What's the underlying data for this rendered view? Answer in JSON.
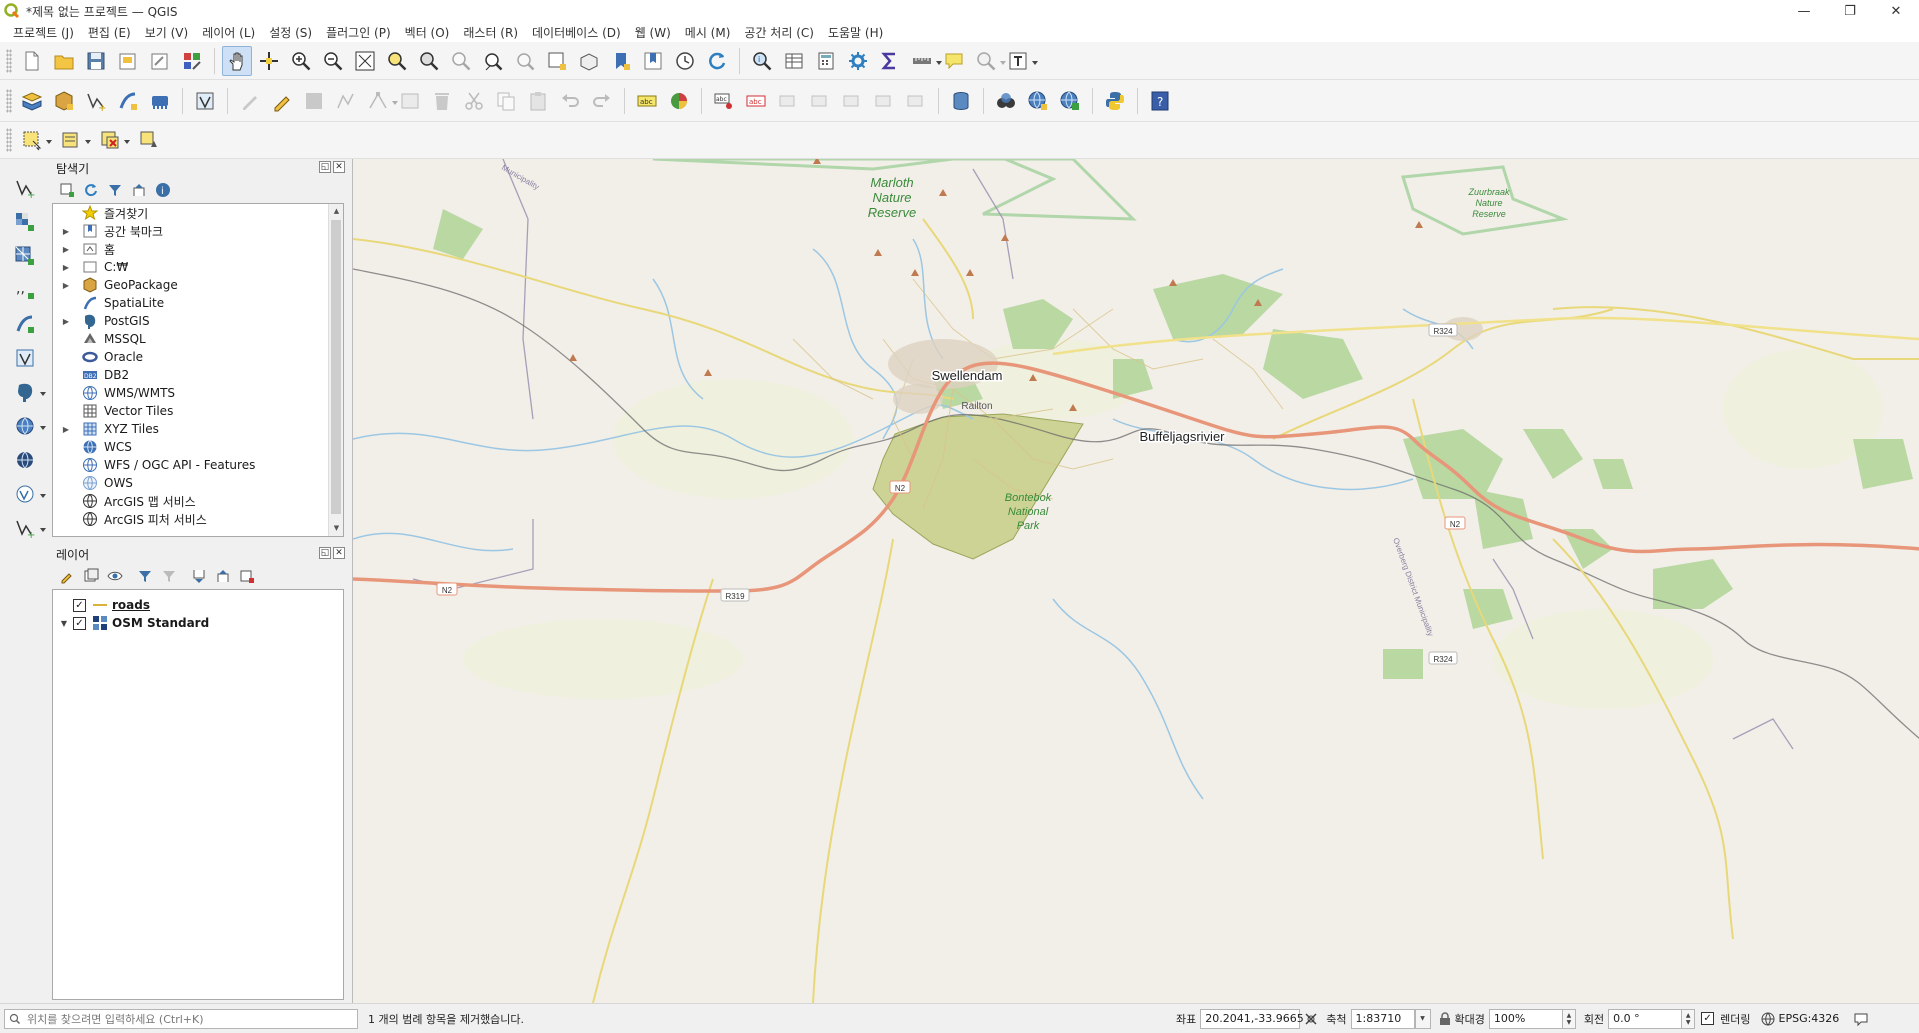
{
  "window": {
    "title": "*제목 없는 프로젝트 — QGIS",
    "minimize": "—",
    "maximize": "❐",
    "close": "✕"
  },
  "menubar": [
    "프로젝트 (J)",
    "편집 (E)",
    "보기 (V)",
    "레이어 (L)",
    "설정 (S)",
    "플러그인 (P)",
    "벡터 (O)",
    "래스터 (R)",
    "데이터베이스 (D)",
    "웹 (W)",
    "메시 (M)",
    "공간 처리 (C)",
    "도움말 (H)"
  ],
  "browser_panel": {
    "title": "탐색기",
    "items": [
      {
        "label": "즐겨찾기",
        "icon": "star-icon",
        "expandable": false
      },
      {
        "label": "공간 북마크",
        "icon": "bookmark-icon",
        "expandable": true
      },
      {
        "label": "홈",
        "icon": "home-folder-icon",
        "expandable": true
      },
      {
        "label": "C:₩",
        "icon": "drive-folder-icon",
        "expandable": true
      },
      {
        "label": "GeoPackage",
        "icon": "geopackage-icon",
        "expandable": true
      },
      {
        "label": "SpatiaLite",
        "icon": "spatialite-icon",
        "expandable": false
      },
      {
        "label": "PostGIS",
        "icon": "postgis-elephant-icon",
        "expandable": true
      },
      {
        "label": "MSSQL",
        "icon": "mssql-icon",
        "expandable": false
      },
      {
        "label": "Oracle",
        "icon": "oracle-icon",
        "expandable": false
      },
      {
        "label": "DB2",
        "icon": "db2-icon",
        "expandable": false
      },
      {
        "label": "WMS/WMTS",
        "icon": "wms-globe-icon",
        "expandable": false
      },
      {
        "label": "Vector Tiles",
        "icon": "vector-tiles-icon",
        "expandable": false
      },
      {
        "label": "XYZ Tiles",
        "icon": "xyz-tiles-icon",
        "expandable": true
      },
      {
        "label": "WCS",
        "icon": "wcs-globe-icon",
        "expandable": false
      },
      {
        "label": "WFS / OGC API - Features",
        "icon": "wfs-globe-icon",
        "expandable": false
      },
      {
        "label": "OWS",
        "icon": "ows-globe-icon",
        "expandable": false
      },
      {
        "label": "ArcGIS 맵 서비스",
        "icon": "arcgis-map-icon",
        "expandable": false
      },
      {
        "label": "ArcGIS 피처 서비스",
        "icon": "arcgis-feature-icon",
        "expandable": false
      }
    ]
  },
  "layers_panel": {
    "title": "레이어",
    "layers": [
      {
        "name": "roads",
        "checked": true,
        "icon": "line-layer-icon"
      },
      {
        "name": "OSM Standard",
        "checked": true,
        "icon": "raster-tile-layer-icon"
      }
    ]
  },
  "map_labels": {
    "marloth": [
      "Marloth",
      "Nature",
      "Reserve"
    ],
    "zuurbraak": [
      "Zuurbraak",
      "Nature",
      "Reserve"
    ],
    "swellendam": "Swellendam",
    "railton": "Railton",
    "buffeljagsrivier": "Buffeljagsrivier",
    "bontebok": [
      "Bontebok",
      "National",
      "Park"
    ],
    "n2_a": "N2",
    "n2_b": "N2",
    "n2_c": "N2",
    "r319": "R319",
    "r324_a": "R324",
    "r324_b": "R324",
    "municipality_left": "Municipality",
    "overberg": "Overberg District Municipality"
  },
  "statusbar": {
    "locator_placeholder": "위치를 찾으려면 입력하세요 (Ctrl+K)",
    "message": "1 개의 범례 항목을 제거했습니다.",
    "coord_label": "좌표",
    "coord_value": "20.2041,-33.9665",
    "scale_label": "축척",
    "scale_value": "1:83710",
    "magnifier_label": "확대경",
    "magnifier_value": "100%",
    "rotation_label": "회전",
    "rotation_value": "0.0 °",
    "render_label": "렌더링",
    "crs": "EPSG:4326"
  },
  "colors": {
    "map_background": "#f2efe9",
    "trunk_road": "#e8967a",
    "secondary_road": "#f0e18a",
    "river": "#9cc7e3",
    "park": "#c6cf86",
    "boundary": "#9a8fb0",
    "nature_reserve_border": "#9fcf9a"
  }
}
